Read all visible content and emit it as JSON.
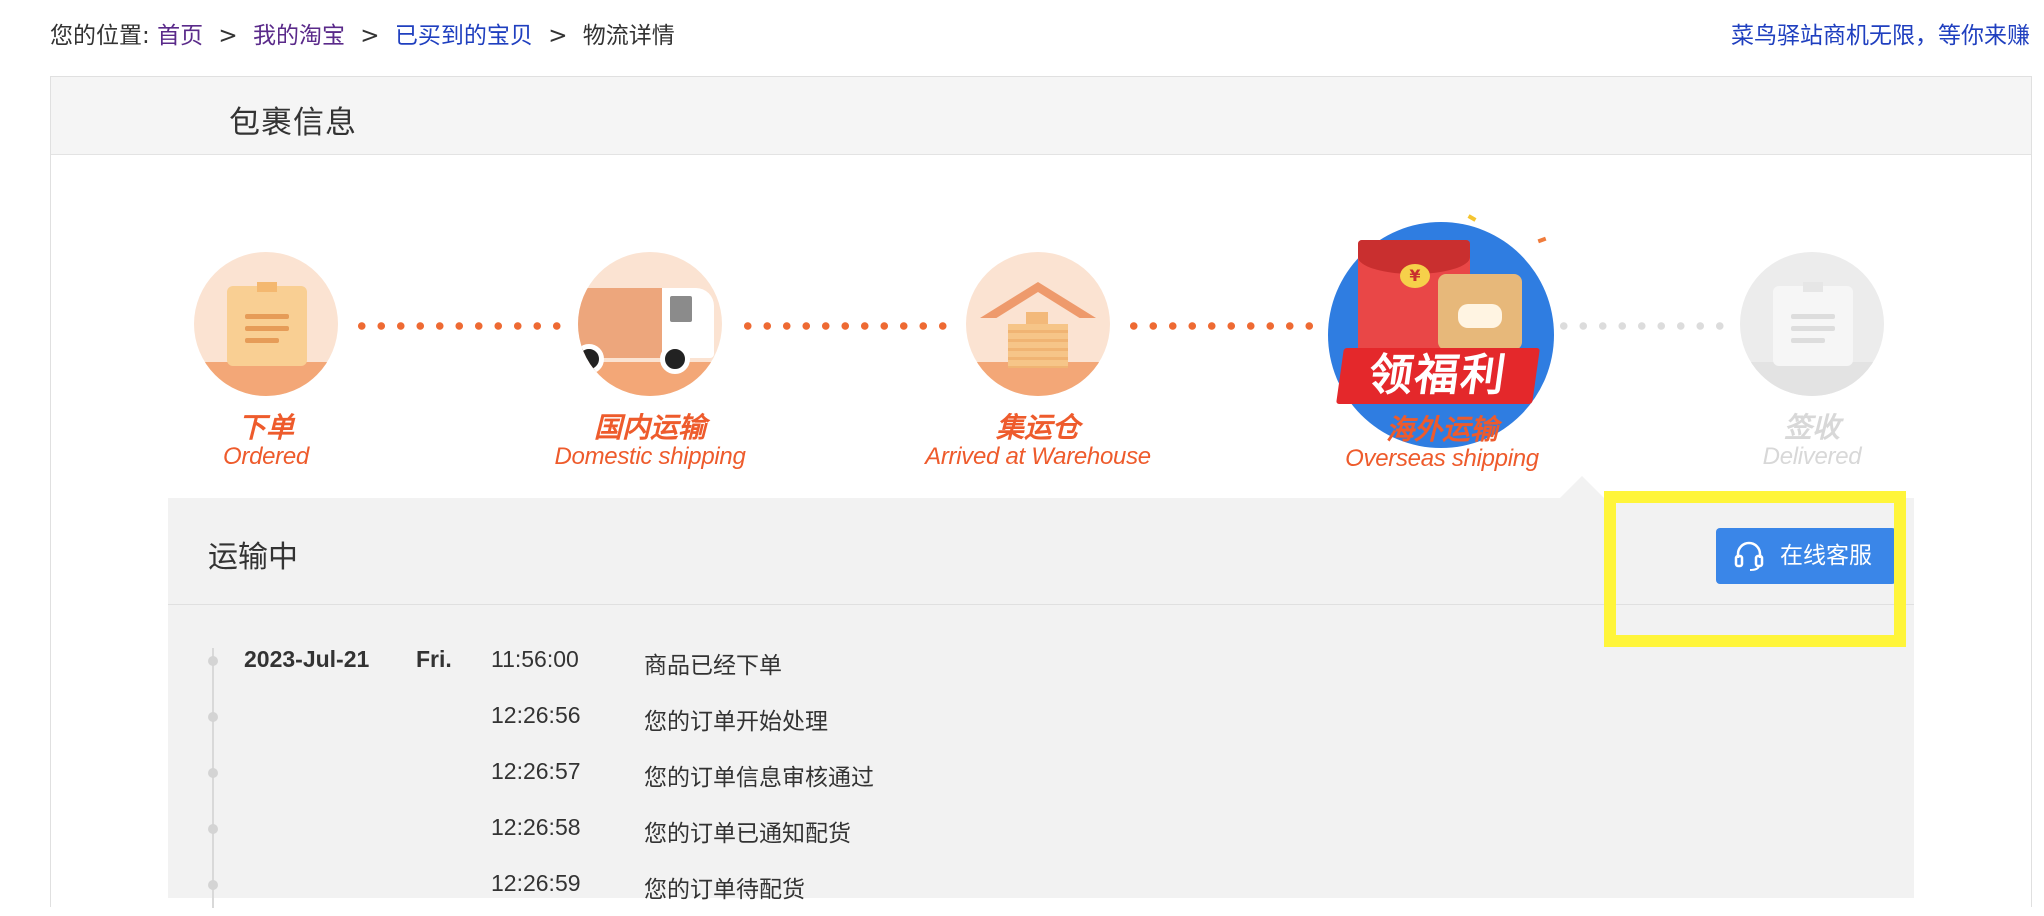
{
  "breadcrumb": {
    "prefix": "您的位置:",
    "items": [
      {
        "label": "首页"
      },
      {
        "label": "我的淘宝"
      },
      {
        "label": "已买到的宝贝"
      },
      {
        "label": "物流详情"
      }
    ],
    "separator": ">"
  },
  "promo_link": "菜鸟驿站商机无限，等你来赚",
  "package": {
    "title": "包裹信息"
  },
  "steps": [
    {
      "cn": "下单",
      "en": "Ordered",
      "status": "done",
      "icon": "document-icon"
    },
    {
      "cn": "国内运输",
      "en": "Domestic shipping",
      "status": "done",
      "icon": "truck-icon"
    },
    {
      "cn": "集运仓",
      "en": "Arrived at Warehouse",
      "status": "done",
      "icon": "warehouse-icon"
    },
    {
      "cn": "海外运输",
      "en": "Overseas shipping",
      "status": "current",
      "icon": "red-envelope-promo-icon",
      "badge": "领福利",
      "coin": "¥"
    },
    {
      "cn": "签收",
      "en": "Delivered",
      "status": "pending",
      "icon": "document-icon"
    }
  ],
  "transit": {
    "title": "运输中",
    "service_button": "在线客服"
  },
  "timeline": [
    {
      "date": "2023-Jul-21",
      "day": "Fri.",
      "time": "11:56:00",
      "text": "商品已经下单"
    },
    {
      "date": "",
      "day": "",
      "time": "12:26:56",
      "text": "您的订单开始处理"
    },
    {
      "date": "",
      "day": "",
      "time": "12:26:57",
      "text": "您的订单信息审核通过"
    },
    {
      "date": "",
      "day": "",
      "time": "12:26:58",
      "text": "您的订单已通知配货"
    },
    {
      "date": "",
      "day": "",
      "time": "12:26:59",
      "text": "您的订单待配货"
    }
  ],
  "colors": {
    "accent_orange": "#ee5b2c",
    "button_blue": "#3a86e8",
    "highlight_yellow": "#fff53a",
    "link_blue": "#1f3fbf",
    "visited_purple": "#5a2a8a"
  }
}
